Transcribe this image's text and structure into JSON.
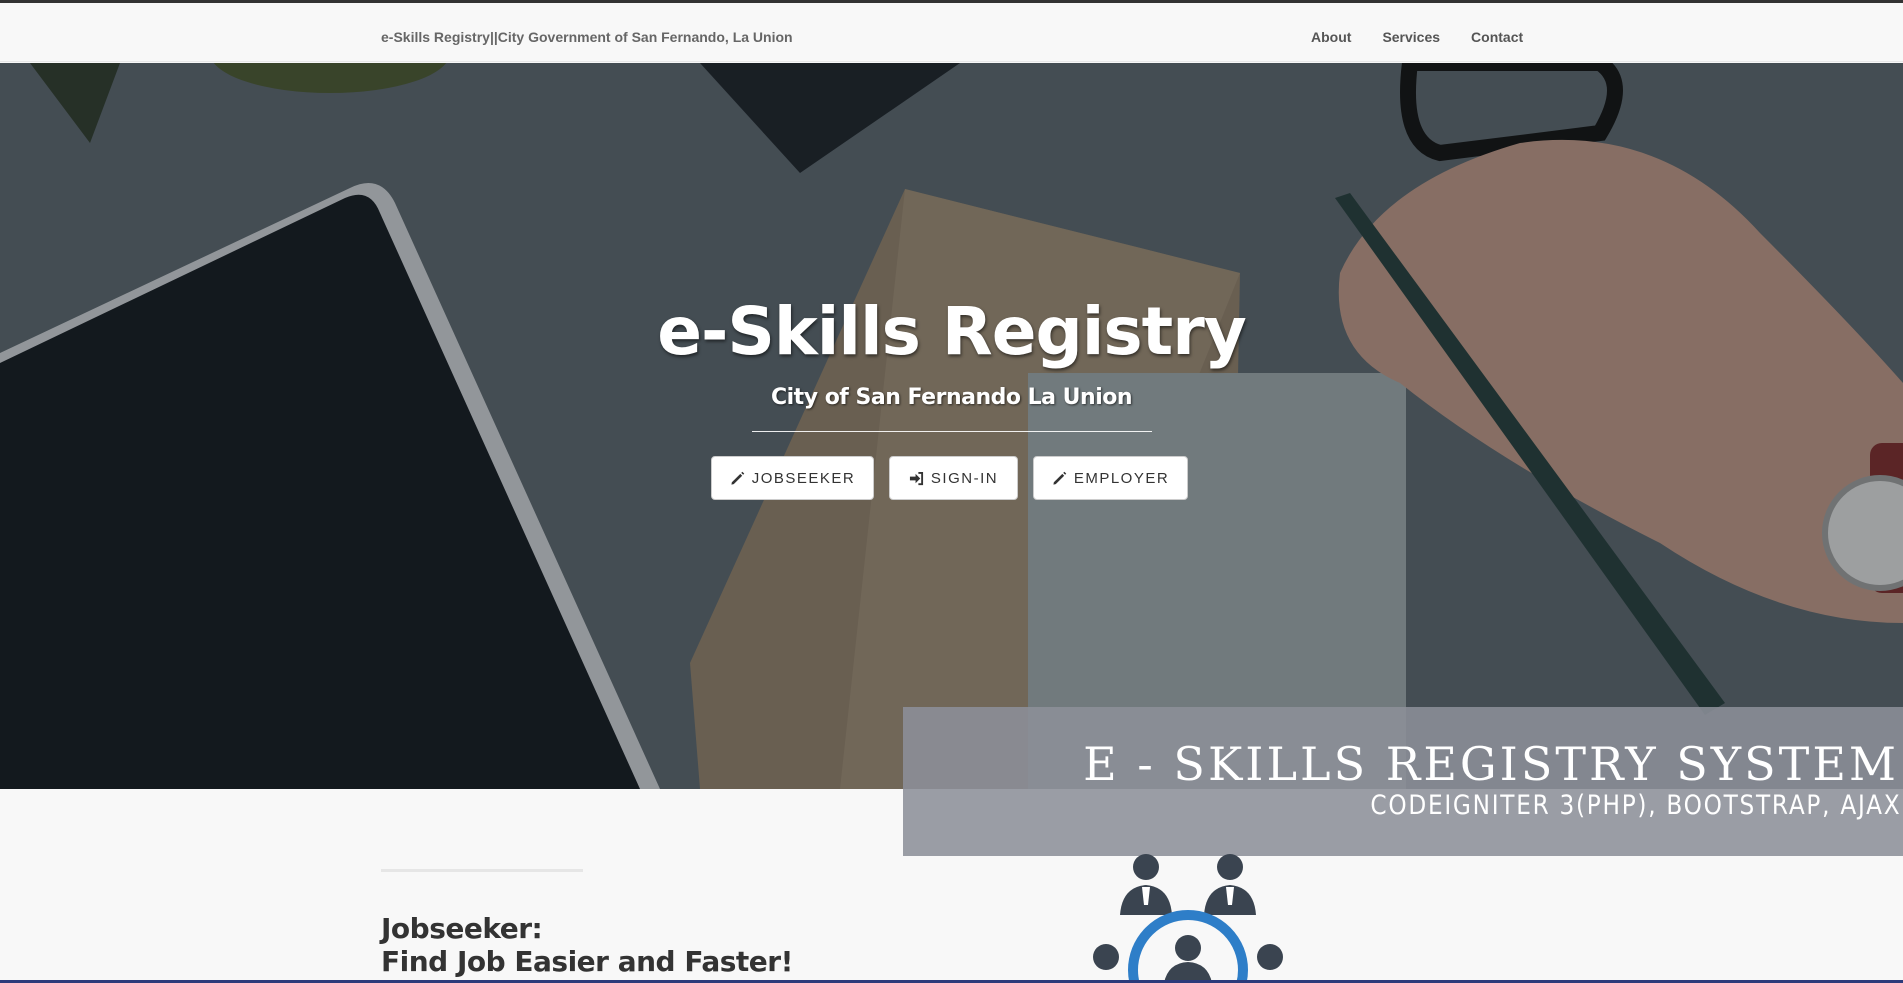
{
  "navbar": {
    "brand": "e-Skills Registry||City Government of San Fernando, La Union",
    "links": [
      "About",
      "Services",
      "Contact"
    ]
  },
  "hero": {
    "title": "e-Skills Registry",
    "subtitle": "City of San Fernando La Union",
    "buttons": [
      {
        "label": "JOBSEEKER",
        "icon": "pencil-icon"
      },
      {
        "label": "SIGN-IN",
        "icon": "sign-in-icon"
      },
      {
        "label": "EMPLOYER",
        "icon": "pencil-icon"
      }
    ]
  },
  "banner": {
    "title": "E - SKILLS REGISTRY SYSTEM",
    "subtitle": "CODEIGNITER 3(PHP), BOOTSTRAP, AJAX"
  },
  "section": {
    "heading_line1": "Jobseeker:",
    "heading_line2": "Find Job Easier and Faster!",
    "icon": "team-icon"
  },
  "colors": {
    "navbar_bg": "#f8f8f8",
    "banner_bg": "#8c9098",
    "team_icon": "#3a4450",
    "team_ring": "#2e7ec8"
  }
}
